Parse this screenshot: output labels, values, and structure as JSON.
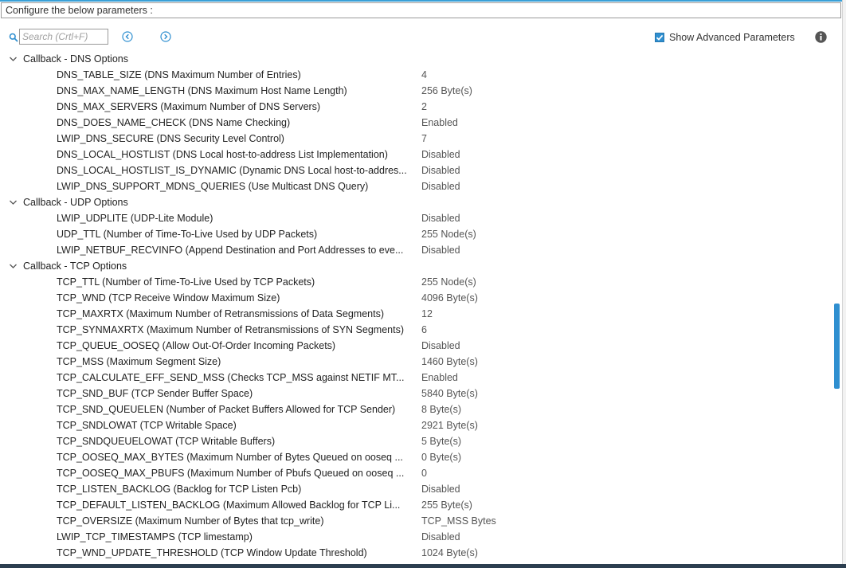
{
  "header": {
    "title": "Configure the below parameters :"
  },
  "toolbar": {
    "search_placeholder": "Search (Crtl+F)",
    "show_advanced_label": "Show Advanced Parameters",
    "show_advanced_checked": true
  },
  "colors": {
    "accent": "#2f8fd0",
    "bottom_bar": "#2c3e50"
  },
  "groups": [
    {
      "label": "Callback - DNS Options",
      "expanded": true,
      "params": [
        {
          "name": "DNS_TABLE_SIZE (DNS Maximum Number of Entries)",
          "value": "4"
        },
        {
          "name": "DNS_MAX_NAME_LENGTH (DNS Maximum Host Name Length)",
          "value": "256 Byte(s)"
        },
        {
          "name": "DNS_MAX_SERVERS (Maximum Number of DNS Servers)",
          "value": "2"
        },
        {
          "name": "DNS_DOES_NAME_CHECK (DNS Name Checking)",
          "value": "Enabled"
        },
        {
          "name": "LWIP_DNS_SECURE (DNS Security Level Control)",
          "value": "7"
        },
        {
          "name": "DNS_LOCAL_HOSTLIST (DNS Local host-to-address List Implementation)",
          "value": "Disabled"
        },
        {
          "name": "DNS_LOCAL_HOSTLIST_IS_DYNAMIC (Dynamic DNS Local host-to-addres...",
          "value": "Disabled"
        },
        {
          "name": "LWIP_DNS_SUPPORT_MDNS_QUERIES (Use Multicast DNS Query)",
          "value": "Disabled"
        }
      ]
    },
    {
      "label": "Callback - UDP Options",
      "expanded": true,
      "params": [
        {
          "name": "LWIP_UDPLITE (UDP-Lite Module)",
          "value": "Disabled"
        },
        {
          "name": "UDP_TTL (Number of Time-To-Live Used by UDP Packets)",
          "value": "255 Node(s)"
        },
        {
          "name": "LWIP_NETBUF_RECVINFO (Append Destination and Port Addresses to eve...",
          "value": "Disabled"
        }
      ]
    },
    {
      "label": "Callback - TCP Options",
      "expanded": true,
      "params": [
        {
          "name": "TCP_TTL (Number of Time-To-Live Used by TCP Packets)",
          "value": "255 Node(s)"
        },
        {
          "name": "TCP_WND (TCP Receive Window Maximum Size)",
          "value": "4096 Byte(s)"
        },
        {
          "name": "TCP_MAXRTX (Maximum Number of Retransmissions of Data Segments)",
          "value": "12"
        },
        {
          "name": "TCP_SYNMAXRTX (Maximum Number of Retransmissions of SYN Segments)",
          "value": "6"
        },
        {
          "name": "TCP_QUEUE_OOSEQ (Allow Out-Of-Order Incoming Packets)",
          "value": "Disabled"
        },
        {
          "name": "TCP_MSS (Maximum Segment Size)",
          "value": "1460 Byte(s)"
        },
        {
          "name": "TCP_CALCULATE_EFF_SEND_MSS (Checks TCP_MSS against NETIF MT...",
          "value": "Enabled"
        },
        {
          "name": "TCP_SND_BUF (TCP Sender Buffer Space)",
          "value": "5840 Byte(s)"
        },
        {
          "name": "TCP_SND_QUEUELEN (Number of Packet Buffers Allowed for TCP Sender)",
          "value": "8 Byte(s)"
        },
        {
          "name": "TCP_SNDLOWAT (TCP Writable Space)",
          "value": "2921 Byte(s)"
        },
        {
          "name": "TCP_SNDQUEUELOWAT (TCP Writable Buffers)",
          "value": "5 Byte(s)"
        },
        {
          "name": "TCP_OOSEQ_MAX_BYTES (Maximum Number of Bytes Queued on ooseq ...",
          "value": "0 Byte(s)"
        },
        {
          "name": "TCP_OOSEQ_MAX_PBUFS (Maximum Number of Pbufs Queued on ooseq ...",
          "value": "0"
        },
        {
          "name": "TCP_LISTEN_BACKLOG (Backlog for TCP Listen Pcb)",
          "value": "Disabled"
        },
        {
          "name": "TCP_DEFAULT_LISTEN_BACKLOG (Maximum Allowed Backlog for TCP Li...",
          "value": "255 Byte(s)"
        },
        {
          "name": "TCP_OVERSIZE (Maximum Number of Bytes that tcp_write)",
          "value": "TCP_MSS Bytes"
        },
        {
          "name": "LWIP_TCP_TIMESTAMPS (TCP limestamp)",
          "value": "Disabled"
        },
        {
          "name": "TCP_WND_UPDATE_THRESHOLD (TCP Window Update Threshold)",
          "value": "1024 Byte(s)"
        }
      ]
    }
  ]
}
